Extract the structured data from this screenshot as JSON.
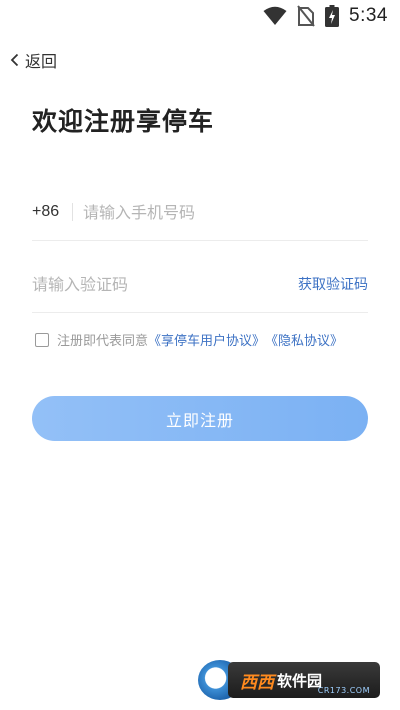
{
  "status_bar": {
    "time": "5:34",
    "icons": [
      "wifi-icon",
      "no-sim-icon",
      "battery-charging-icon"
    ]
  },
  "nav": {
    "back_label": "返回"
  },
  "page": {
    "title": "欢迎注册享停车"
  },
  "form": {
    "phone_prefix": "+86",
    "phone_placeholder": "请输入手机号码",
    "phone_value": "",
    "code_placeholder": "请输入验证码",
    "code_value": "",
    "get_code_label": "获取验证码"
  },
  "agreement": {
    "checked": false,
    "text": "注册即代表同意",
    "user_agreement_link": "《享停车用户协议》",
    "privacy_link": "《隐私协议》"
  },
  "register_button_label": "立即注册",
  "watermark": {
    "text_main": "西西",
    "text_sub": "软件园",
    "url": "CR173.COM"
  },
  "colors": {
    "accent": "#3d72c4",
    "button": "#88b8f5",
    "placeholder": "#b5b5b5",
    "text": "#222222"
  }
}
